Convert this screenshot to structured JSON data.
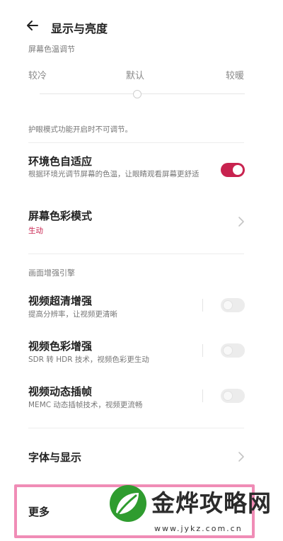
{
  "header": {
    "title": "显示与亮度"
  },
  "color_temp": {
    "section_label": "屏幕色温调节",
    "cool": "较冷",
    "default": "默认",
    "warm": "较暖",
    "note": "护眼模式功能开启时不可调节。"
  },
  "ambient_color": {
    "title": "环境色自适应",
    "subtitle": "根据环境光调节屏幕的色温，让眼睛观看屏幕更舒适",
    "enabled": true
  },
  "color_mode": {
    "title": "屏幕色彩模式",
    "value": "生动"
  },
  "enhance": {
    "section_label": "画面增强引擎",
    "items": [
      {
        "title": "视频超清增强",
        "subtitle": "提高分辨率，让视频更清晰",
        "enabled": false
      },
      {
        "title": "视频色彩增强",
        "subtitle": "SDR 转 HDR 技术，视频色彩更生动",
        "enabled": false
      },
      {
        "title": "视频动态插帧",
        "subtitle": "MEMC 动态插帧技术，视频更流畅",
        "enabled": false
      }
    ]
  },
  "font_display": {
    "title": "字体与显示"
  },
  "more": {
    "title": "更多"
  },
  "watermark": {
    "text": "金烨攻略网",
    "url": "www.jykz.com.cn"
  },
  "colors": {
    "accent": "#c8234f",
    "highlight": "#f08cb6"
  }
}
